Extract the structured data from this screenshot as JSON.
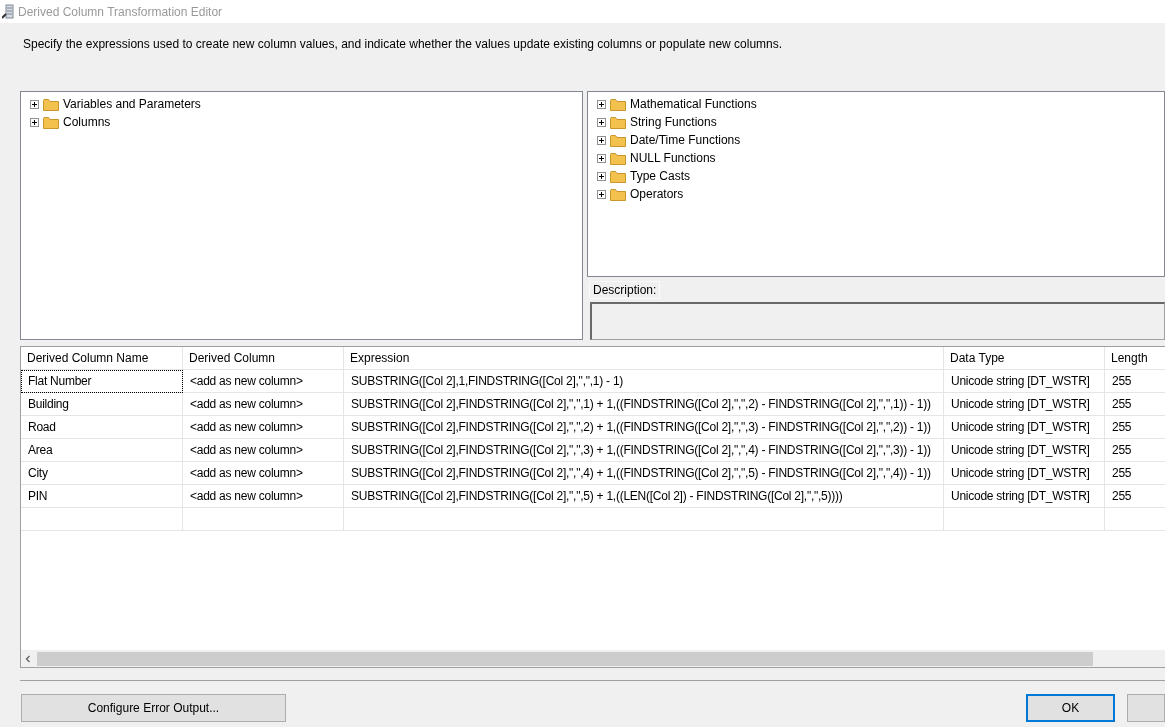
{
  "window": {
    "title": "Derived Column Transformation Editor"
  },
  "instructions": "Specify the expressions used to create new column values, and indicate whether the values update existing columns or populate new columns.",
  "input_tree": {
    "items": [
      {
        "label": "Variables and Parameters",
        "expanded": false
      },
      {
        "label": "Columns",
        "expanded": false
      }
    ]
  },
  "function_tree": {
    "items": [
      {
        "label": "Mathematical Functions",
        "expanded": false
      },
      {
        "label": "String Functions",
        "expanded": false
      },
      {
        "label": "Date/Time Functions",
        "expanded": false
      },
      {
        "label": "NULL Functions",
        "expanded": false
      },
      {
        "label": "Type Casts",
        "expanded": false
      },
      {
        "label": "Operators",
        "expanded": false
      }
    ]
  },
  "description": {
    "label": "Description:"
  },
  "table": {
    "columns": [
      "Derived Column Name",
      "Derived Column",
      "Expression",
      "Data Type",
      "Length"
    ],
    "rows": [
      {
        "cells": [
          "Flat Number",
          "<add as new column>",
          "SUBSTRING([Col 2],1,FINDSTRING([Col 2],\",\",1) - 1)",
          "Unicode string [DT_WSTR]",
          "255"
        ],
        "focused": true
      },
      {
        "cells": [
          "Building",
          "<add as new column>",
          "SUBSTRING([Col 2],FINDSTRING([Col 2],\",\",1) + 1,((FINDSTRING([Col 2],\",\",2) - FINDSTRING([Col 2],\",\",1)) - 1))",
          "Unicode string [DT_WSTR]",
          "255"
        ],
        "focused": false
      },
      {
        "cells": [
          "Road",
          "<add as new column>",
          "SUBSTRING([Col 2],FINDSTRING([Col 2],\",\",2) + 1,((FINDSTRING([Col 2],\",\",3) - FINDSTRING([Col 2],\",\",2)) - 1))",
          "Unicode string [DT_WSTR]",
          "255"
        ],
        "focused": false
      },
      {
        "cells": [
          "Area",
          "<add as new column>",
          "SUBSTRING([Col 2],FINDSTRING([Col 2],\",\",3) + 1,((FINDSTRING([Col 2],\",\",4) - FINDSTRING([Col 2],\",\",3)) - 1))",
          "Unicode string [DT_WSTR]",
          "255"
        ],
        "focused": false
      },
      {
        "cells": [
          "City",
          "<add as new column>",
          "SUBSTRING([Col 2],FINDSTRING([Col 2],\",\",4) + 1,((FINDSTRING([Col 2],\",\",5) - FINDSTRING([Col 2],\",\",4)) - 1))",
          "Unicode string [DT_WSTR]",
          "255"
        ],
        "focused": false
      },
      {
        "cells": [
          "PIN",
          "<add as new column>",
          "SUBSTRING([Col 2],FINDSTRING([Col 2],\",\",5) + 1,((LEN([Col 2]) - FINDSTRING([Col 2],\",\",5))))",
          "Unicode string [DT_WSTR]",
          "255"
        ],
        "focused": false
      }
    ]
  },
  "buttons": [
    {
      "label": "Configure Error Output...",
      "kind": "normal"
    },
    {
      "label": "OK",
      "kind": "default"
    }
  ]
}
